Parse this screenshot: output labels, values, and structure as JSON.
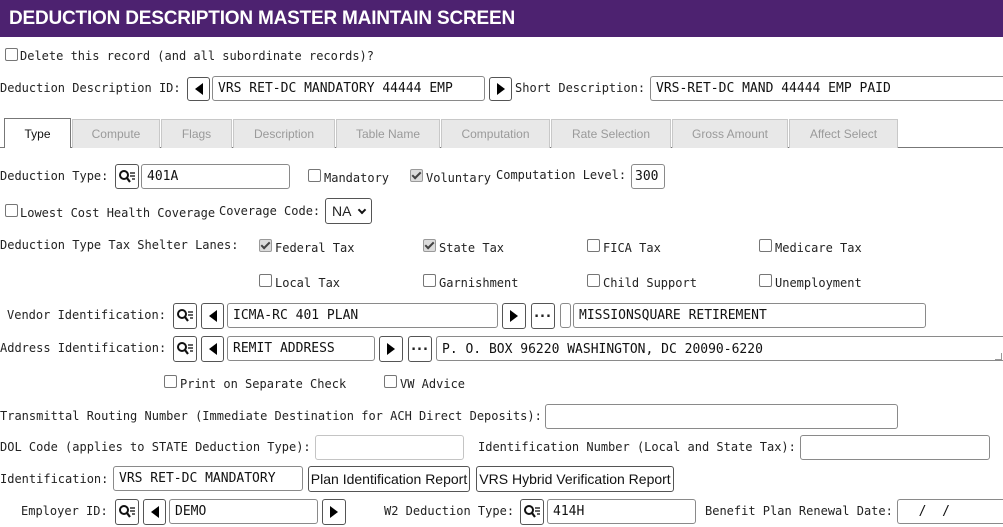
{
  "screen_title": "DEDUCTION DESCRIPTION MASTER MAINTAIN SCREEN",
  "delete_record_label": "Delete this record (and all subordinate records)?",
  "deduction_description_id": {
    "label": "Deduction Description ID:",
    "value": "VRS RET-DC MANDATORY 44444  EMP"
  },
  "short_description": {
    "label": "Short Description:",
    "value": "VRS-RET-DC MAND 44444  EMP PAID"
  },
  "tabs": [
    {
      "label": "Type",
      "active": true
    },
    {
      "label": "Compute"
    },
    {
      "label": "Flags"
    },
    {
      "label": "Description"
    },
    {
      "label": "Table Name"
    },
    {
      "label": "Computation"
    },
    {
      "label": "Rate Selection"
    },
    {
      "label": "Gross Amount"
    },
    {
      "label": "Affect Select"
    }
  ],
  "deduction_type": {
    "label": "Deduction Type:",
    "value": "401A"
  },
  "mandatory": {
    "label": "Mandatory",
    "checked": false
  },
  "voluntary": {
    "label": "Voluntary",
    "checked": true
  },
  "computation_level": {
    "label": "Computation Level:",
    "value": "300"
  },
  "lowest_cost_health": {
    "label": "Lowest Cost Health Coverage",
    "checked": false
  },
  "coverage_code": {
    "label": "Coverage Code:",
    "value": "NA"
  },
  "tax_shelter": {
    "label": "Deduction Type Tax Shelter Lanes:",
    "items": [
      {
        "label": "Federal Tax",
        "checked": true
      },
      {
        "label": "State Tax",
        "checked": true
      },
      {
        "label": "FICA Tax",
        "checked": false
      },
      {
        "label": "Medicare Tax",
        "checked": false
      },
      {
        "label": "Local Tax",
        "checked": false
      },
      {
        "label": "Garnishment",
        "checked": false
      },
      {
        "label": "Child Support",
        "checked": false
      },
      {
        "label": "Unemployment",
        "checked": false
      }
    ]
  },
  "vendor": {
    "label": "Vendor Identification:",
    "value": "ICMA-RC 401 PLAN",
    "name": "MISSIONSQUARE RETIREMENT"
  },
  "address": {
    "label": "Address Identification:",
    "value": "REMIT ADDRESS",
    "detail": "P. O. BOX 96220 WASHINGTON, DC  20090-6220"
  },
  "print_separate_check": {
    "label": "Print on Separate Check",
    "checked": false
  },
  "vw_advice": {
    "label": "VW Advice",
    "checked": false
  },
  "transmittal_routing": {
    "label": "Transmittal Routing Number (Immediate Destination for ACH Direct Deposits):",
    "value": ""
  },
  "dol_code": {
    "label": "DOL Code (applies to STATE Deduction Type):",
    "value": ""
  },
  "identification_number": {
    "label": "Identification Number (Local and State Tax):",
    "value": ""
  },
  "identification": {
    "label": "Identification:",
    "value": "VRS RET-DC MANDATORY"
  },
  "plan_identification_report_button": "Plan Identification Report",
  "vrs_hybrid_verification_report_button": "VRS Hybrid Verification Report",
  "employer_id": {
    "label": "Employer ID:",
    "value": "DEMO"
  },
  "w2_deduction_type": {
    "label": "W2 Deduction Type:",
    "value": "414H"
  },
  "benefit_plan_renewal_date": {
    "label": "Benefit Plan Renewal Date:",
    "value": "  /  /"
  },
  "icons": {
    "lookup": "search-list-icon",
    "prev": "triangle-left-icon",
    "next": "triangle-right-icon",
    "more": "ellipsis-icon"
  },
  "colors": {
    "title_bar": "#4d2270",
    "title_text": "#ffffff"
  }
}
